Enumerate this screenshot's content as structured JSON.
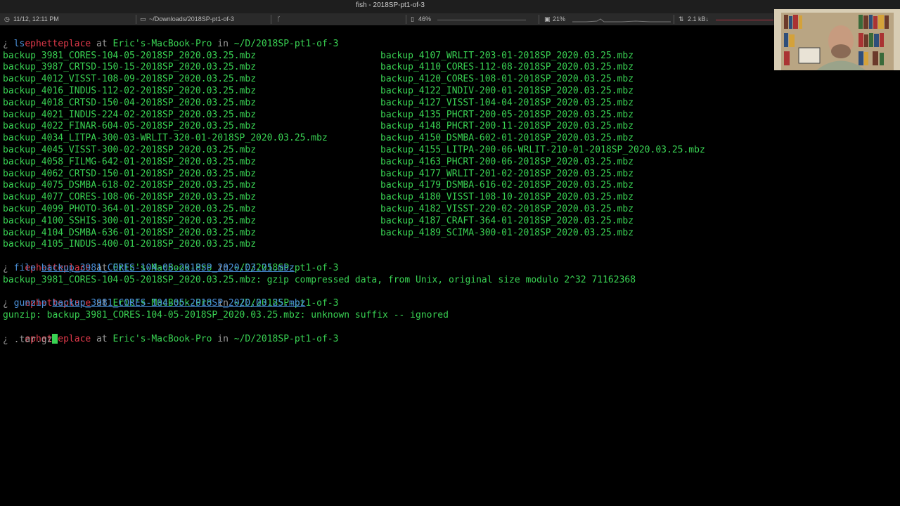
{
  "window": {
    "title": "fish - 2018SP-pt1-of-3",
    "clock": "11/12, 12:11 PM",
    "folder": "~/Downloads/2018SP-pt1-of-3",
    "battery": "46%",
    "cpu": "21%",
    "network": "2.1 kB↓"
  },
  "prompt": {
    "user": "ephetteplace",
    "at": " at ",
    "host": "Eric's-MacBook-Pro",
    "in": " in ",
    "path": "~/D/2018SP-pt1-of-3",
    "marker": "¿"
  },
  "commands": {
    "ls": "ls",
    "file": "file",
    "file_arg": "backup_3981_CORES-104-05-2018SP_2020.03.25.mbz",
    "file_output": "backup_3981_CORES-104-05-2018SP_2020.03.25.mbz: gzip compressed data, from Unix, original size modulo 2^32 71162368",
    "gunzip": "gunzip",
    "gunzip_arg": "backup_3981_CORES-104-05-2018SP_2020.03.25.mbz",
    "gunzip_output": "gunzip: backup_3981_CORES-104-05-2018SP_2020.03.25.mbz: unknown suffix -- ignored",
    "current_input": ".tar.gz"
  },
  "listing": {
    "col1": [
      "backup_3981_CORES-104-05-2018SP_2020.03.25.mbz",
      "backup_3987_CRTSD-150-15-2018SP_2020.03.25.mbz",
      "backup_4012_VISST-108-09-2018SP_2020.03.25.mbz",
      "backup_4016_INDUS-112-02-2018SP_2020.03.25.mbz",
      "backup_4018_CRTSD-150-04-2018SP_2020.03.25.mbz",
      "backup_4021_INDUS-224-02-2018SP_2020.03.25.mbz",
      "backup_4022_FINAR-604-05-2018SP_2020.03.25.mbz",
      "backup_4034_LITPA-300-03-WRLIT-320-01-2018SP_2020.03.25.mbz",
      "backup_4045_VISST-300-02-2018SP_2020.03.25.mbz",
      "backup_4058_FILMG-642-01-2018SP_2020.03.25.mbz",
      "backup_4062_CRTSD-150-01-2018SP_2020.03.25.mbz",
      "backup_4075_DSMBA-618-02-2018SP_2020.03.25.mbz",
      "backup_4077_CORES-108-06-2018SP_2020.03.25.mbz",
      "backup_4099_PHOTO-364-01-2018SP_2020.03.25.mbz",
      "backup_4100_SSHIS-300-01-2018SP_2020.03.25.mbz",
      "backup_4104_DSMBA-636-01-2018SP_2020.03.25.mbz",
      "backup_4105_INDUS-400-01-2018SP_2020.03.25.mbz"
    ],
    "col2": [
      "backup_4107_WRLIT-203-01-2018SP_2020.03.25.mbz",
      "backup_4110_CORES-112-08-2018SP_2020.03.25.mbz",
      "backup_4120_CORES-108-01-2018SP_2020.03.25.mbz",
      "backup_4122_INDIV-200-01-2018SP_2020.03.25.mbz",
      "backup_4127_VISST-104-04-2018SP_2020.03.25.mbz",
      "backup_4135_PHCRT-200-05-2018SP_2020.03.25.mbz",
      "backup_4148_PHCRT-200-11-2018SP_2020.03.25.mbz",
      "backup_4150_DSMBA-602-01-2018SP_2020.03.25.mbz",
      "backup_4155_LITPA-200-06-WRLIT-210-01-2018SP_2020.03.25.mbz",
      "backup_4163_PHCRT-200-06-2018SP_2020.03.25.mbz",
      "backup_4177_WRLIT-201-02-2018SP_2020.03.25.mbz",
      "backup_4179_DSMBA-616-02-2018SP_2020.03.25.mbz",
      "backup_4180_VISST-108-10-2018SP_2020.03.25.mbz",
      "backup_4182_VISST-220-02-2018SP_2020.03.25.mbz",
      "backup_4187_CRAFT-364-01-2018SP_2020.03.25.mbz",
      "backup_4189_SCIMA-300-01-2018SP_2020.03.25.mbz"
    ]
  }
}
